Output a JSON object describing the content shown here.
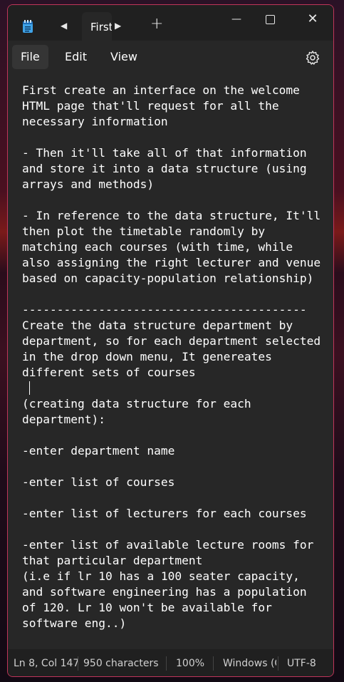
{
  "tabs": [
    {
      "title": "First create an interface"
    }
  ],
  "menu": {
    "file": "File",
    "edit": "Edit",
    "view": "View"
  },
  "editor": {
    "lines": [
      "First create an interface on the welcome",
      "HTML page that'll request for all the",
      "necessary information",
      "",
      "- Then it'll take all of that information",
      "and store it into a data structure (using",
      "arrays and methods)",
      "",
      "- In reference to the data structure, It'll",
      "then plot the timetable randomly by",
      "matching each courses (with time, while",
      "also assigning the right lecturer and venue",
      "based on capacity-population relationship)",
      "",
      "-----------------------------------------",
      "Create the data structure department by",
      "department, so for each department selected",
      "in the drop down menu, It genereates",
      "different sets of courses",
      "",
      "(creating data structure for each",
      "department):",
      "",
      "-enter department name",
      "",
      "-enter list of courses",
      "",
      "-enter list of lecturers for each courses",
      "",
      "-enter list of available lecture rooms for",
      "that particular department",
      "(i.e if lr 10 has a 100 seater capacity,",
      "and software engineering has a population",
      "of 120. Lr 10 won't be available for",
      "software eng..)"
    ],
    "caret_line": 19
  },
  "status": {
    "position": "Ln 8, Col 147",
    "characters": "950 characters",
    "zoom": "100%",
    "line_ending": "Windows (CRLF)",
    "encoding": "UTF-8"
  },
  "icons": {
    "app": "notepad-icon",
    "prev": "chevron-left-icon",
    "next": "chevron-right-icon",
    "add": "plus-icon",
    "minimize": "minimize-icon",
    "maximize": "maximize-icon",
    "close": "close-icon",
    "settings": "gear-icon"
  },
  "colors": {
    "accent_border": "#c0355a",
    "window_bg": "#272727",
    "chrome_bg": "#202020",
    "text": "#ffffff"
  }
}
